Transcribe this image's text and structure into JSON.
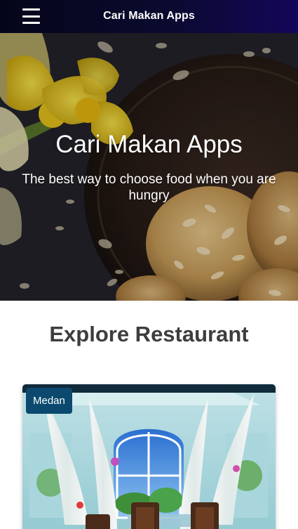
{
  "app_bar": {
    "menu_icon": "hamburger-menu-icon",
    "title": "Cari Makan Apps"
  },
  "hero": {
    "title": "Cari Makan Apps",
    "tagline": "The best way to choose food when you are hungry"
  },
  "explore": {
    "title": "Explore Restaurant",
    "restaurants": [
      {
        "city": "Medan"
      }
    ]
  },
  "colors": {
    "app_bar_start": "#05051a",
    "app_bar_end": "#14065a",
    "section_title": "#3d3d3d",
    "badge_background": "#0b4a6e"
  }
}
